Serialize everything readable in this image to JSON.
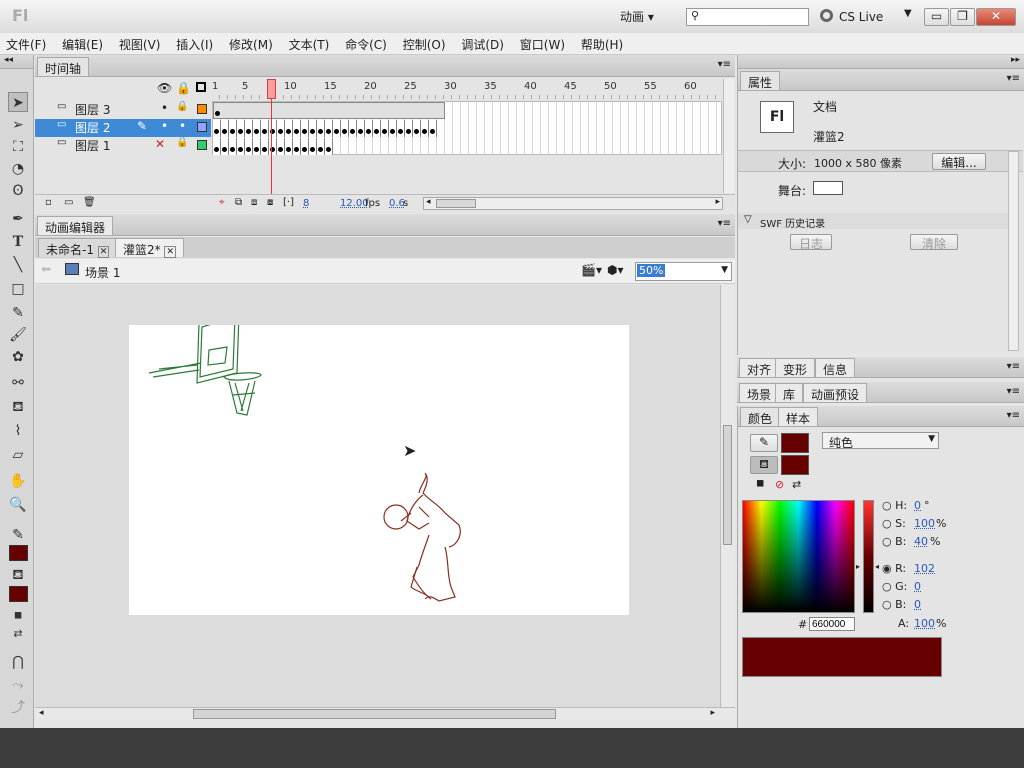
{
  "app": {
    "logo": "Fl",
    "workspace": "动画",
    "search_placeholder": "",
    "cs_live": "CS Live"
  },
  "menu": [
    "文件(F)",
    "编辑(E)",
    "视图(V)",
    "插入(I)",
    "修改(M)",
    "文本(T)",
    "命令(C)",
    "控制(O)",
    "调试(D)",
    "窗口(W)",
    "帮助(H)"
  ],
  "timeline": {
    "title": "时间轴",
    "ruler": [
      "1",
      "5",
      "10",
      "15",
      "20",
      "25",
      "30",
      "35",
      "40",
      "45",
      "50",
      "55",
      "60"
    ],
    "layers": [
      {
        "name": "图层 3",
        "state": "normal",
        "color": "#ff8a00"
      },
      {
        "name": "图层 2",
        "state": "selected",
        "color": "#8ea6ff"
      },
      {
        "name": "图层 1",
        "state": "hidden",
        "color": "#33cc66"
      }
    ],
    "current_frame": "8",
    "fps": "12.00",
    "fps_unit": "fps",
    "time": "0.6",
    "time_unit": "s"
  },
  "motion_editor": {
    "title": "动画编辑器"
  },
  "doc_tabs": [
    {
      "label": "未命名-1"
    },
    {
      "label": "灌篮2*"
    }
  ],
  "scene": {
    "label": "场景 1",
    "zoom": "50%"
  },
  "properties": {
    "title": "属性",
    "doc_icon": "Fl",
    "doc_type": "文档",
    "doc_name": "灌篮2",
    "size_label": "大小:",
    "size_value": "1000 x 580 像素",
    "edit_btn": "编辑...",
    "stage_label": "舞台:",
    "swf_history": "SWF 历史记录",
    "log_btn": "日志",
    "clear_btn": "清除"
  },
  "panels": {
    "row1": [
      "对齐",
      "变形",
      "信息"
    ],
    "row2": [
      "场景",
      "库",
      "动画预设"
    ],
    "row3": [
      "颜色",
      "样本"
    ]
  },
  "color": {
    "fill_type": "纯色",
    "h_label": "H:",
    "h_value": "0",
    "h_unit": "°",
    "s_label": "S:",
    "s_value": "100",
    "s_unit": "%",
    "b_label": "B:",
    "b_value": "40",
    "b_unit": "%",
    "r_label": "R:",
    "r_value": "102",
    "g_label": "G:",
    "g_value": "0",
    "bl_label": "B:",
    "bl_value": "0",
    "hex_label": "#",
    "hex_value": "660000",
    "a_label": "A:",
    "a_value": "100",
    "a_unit": "%",
    "stroke_color": "#660000",
    "fill_color": "#660000"
  }
}
